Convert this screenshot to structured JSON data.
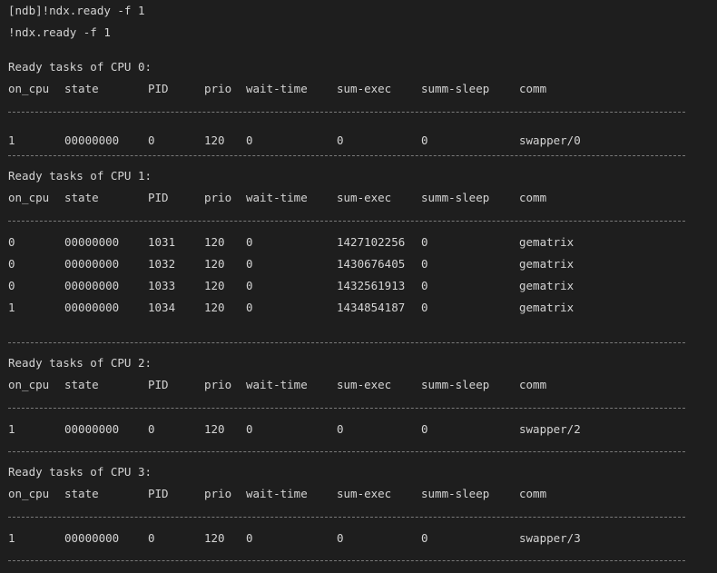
{
  "command_echo": "[ndb]!ndx.ready -f 1",
  "command": "!ndx.ready -f 1",
  "columns": [
    "on_cpu",
    "state",
    "PID",
    "prio",
    "wait-time",
    "sum-exec",
    "summ-sleep",
    "comm"
  ],
  "cpus": [
    {
      "header": "Ready tasks of CPU 0:",
      "rows": [
        [
          "1",
          "00000000",
          "0",
          "120",
          "0",
          "0",
          "0",
          "swapper/0"
        ]
      ]
    },
    {
      "header": "Ready tasks of CPU 1:",
      "rows": [
        [
          "0",
          "00000000",
          "1031",
          "120",
          "0",
          "1427102256",
          "0",
          "gematrix"
        ],
        [
          "0",
          "00000000",
          "1032",
          "120",
          "0",
          "1430676405",
          "0",
          "gematrix"
        ],
        [
          "0",
          "00000000",
          "1033",
          "120",
          "0",
          "1432561913",
          "0",
          "gematrix"
        ],
        [
          "1",
          "00000000",
          "1034",
          "120",
          "0",
          "1434854187",
          "0",
          "gematrix"
        ]
      ]
    },
    {
      "header": "Ready tasks of CPU 2:",
      "rows": [
        [
          "1",
          "00000000",
          "0",
          "120",
          "0",
          "0",
          "0",
          "swapper/2"
        ]
      ]
    },
    {
      "header": "Ready tasks of CPU 3:",
      "rows": [
        [
          "1",
          "00000000",
          "0",
          "120",
          "0",
          "0",
          "0",
          "swapper/3"
        ]
      ]
    }
  ]
}
